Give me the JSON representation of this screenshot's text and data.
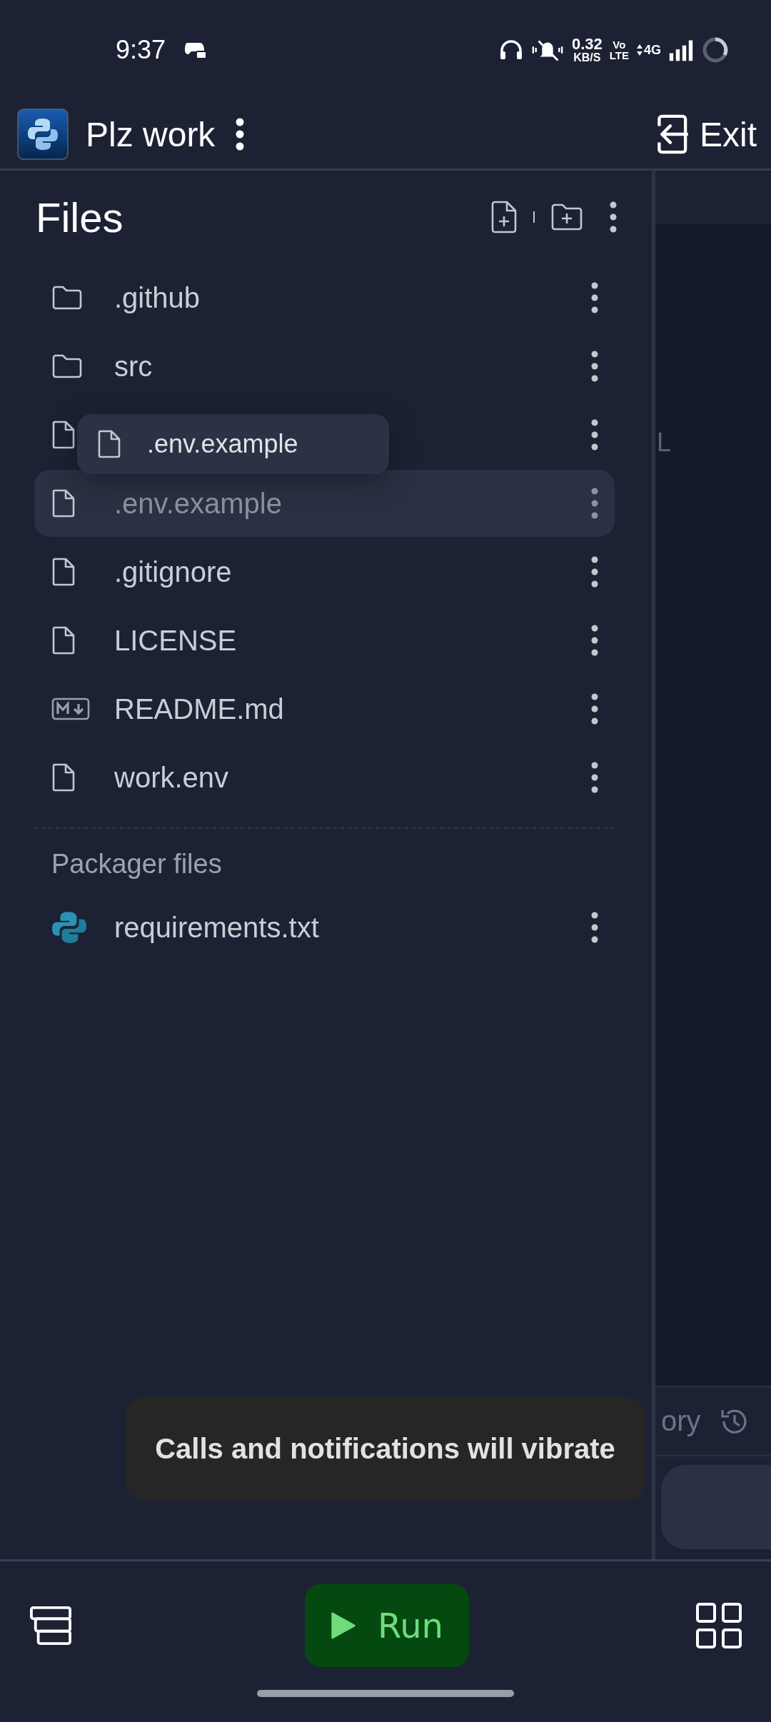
{
  "status_bar": {
    "time": "9:37",
    "speed": "0.32",
    "speed_unit": "KB/S",
    "volte_top": "Vo",
    "volte_bottom": "LTE",
    "network": "4G"
  },
  "header": {
    "title": "Plz work",
    "exit_label": "Exit"
  },
  "files_panel": {
    "title": "Files",
    "items": [
      {
        "kind": "folder",
        "name": ".github",
        "selected": false
      },
      {
        "kind": "folder",
        "name": "src",
        "selected": false
      },
      {
        "kind": "file",
        "selected": false
      },
      {
        "kind": "file",
        "name": ".env.example",
        "selected": true
      },
      {
        "kind": "file",
        "name": ".gitignore",
        "selected": false
      },
      {
        "kind": "file",
        "name": "LICENSE",
        "selected": false
      },
      {
        "kind": "markdown",
        "name": "README.md",
        "selected": false
      },
      {
        "kind": "file",
        "name": "work.env",
        "selected": false
      }
    ],
    "packager_title": "Packager files",
    "packager_items": [
      {
        "kind": "python",
        "name": "requirements.txt",
        "selected": false
      }
    ]
  },
  "drag_preview": {
    "name": ".env.example"
  },
  "side_pane": {
    "cut_text": "L",
    "tab_text": "ory"
  },
  "toast": {
    "message": "Calls and notifications will vibrate"
  },
  "bottom_bar": {
    "run_label": "Run"
  }
}
